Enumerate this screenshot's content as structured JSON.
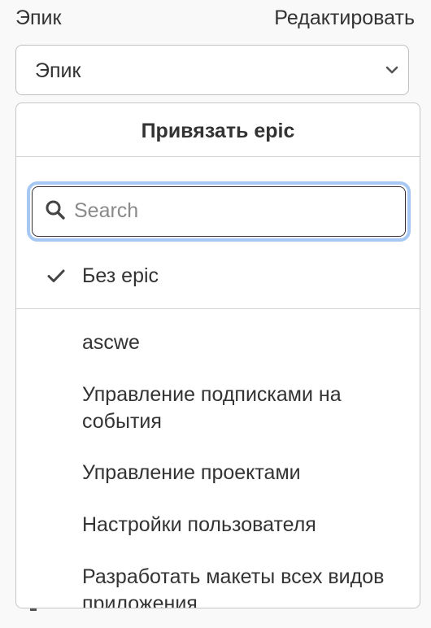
{
  "field": {
    "label": "Эпик",
    "edit_label": "Редактировать",
    "selected_value": "Эпик"
  },
  "dropdown": {
    "title": "Привязать epic",
    "search": {
      "placeholder": "Search",
      "value": ""
    },
    "no_epic": {
      "label": "Без epic",
      "checked": true
    },
    "options": [
      {
        "label": "ascwe"
      },
      {
        "label": "Управление подписками на события"
      },
      {
        "label": "Управление проектами"
      },
      {
        "label": "Настройки пользователя"
      },
      {
        "label": "Разработать макеты всех видов приложения"
      }
    ]
  },
  "icons": {
    "toggle": "chevron-down-icon",
    "search": "search-icon",
    "selected": "check-icon"
  },
  "colors": {
    "focus_ring": "#a7c8f3",
    "text": "#333333",
    "placeholder": "#8a8a8a",
    "border": "#bfbfbf"
  }
}
